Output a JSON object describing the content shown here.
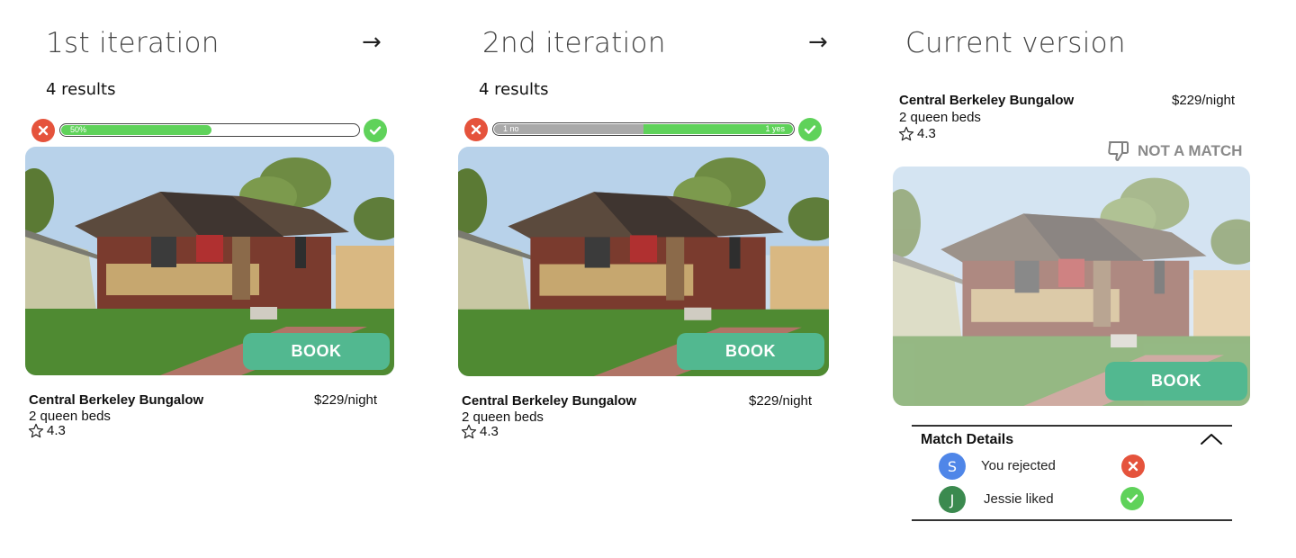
{
  "iterations": [
    {
      "heading": "1st iteration",
      "results": "4 results",
      "bar_label": "50%",
      "bar_fill_fraction": 0.5
    },
    {
      "heading": "2nd iteration",
      "results": "4 results",
      "bar_no_label": "1 no",
      "bar_yes_label": "1 yes",
      "bar_no_fraction": 0.5,
      "bar_yes_fraction": 0.5
    },
    {
      "heading": "Current version"
    }
  ],
  "arrow_glyph": "→",
  "listing": {
    "title": "Central Berkeley Bungalow",
    "price": "$229/night",
    "beds": "2 queen beds",
    "rating": "4.3",
    "book_label": "BOOK"
  },
  "not_a_match_label": "NOT A MATCH",
  "match_details": {
    "title": "Match Details",
    "rows": [
      {
        "initial": "S",
        "text": "You rejected",
        "status": "rejected",
        "avatar_color": "#4f86e8"
      },
      {
        "initial": "J",
        "text": "Jessie liked",
        "status": "liked",
        "avatar_color": "#3b8a4f"
      }
    ]
  },
  "colors": {
    "book": "#52b890",
    "reject": "#e5533c",
    "like": "#5fd25a"
  },
  "icons": [
    "close-icon",
    "check-icon",
    "star-icon",
    "thumbs-down-icon",
    "chevron-up-icon"
  ]
}
